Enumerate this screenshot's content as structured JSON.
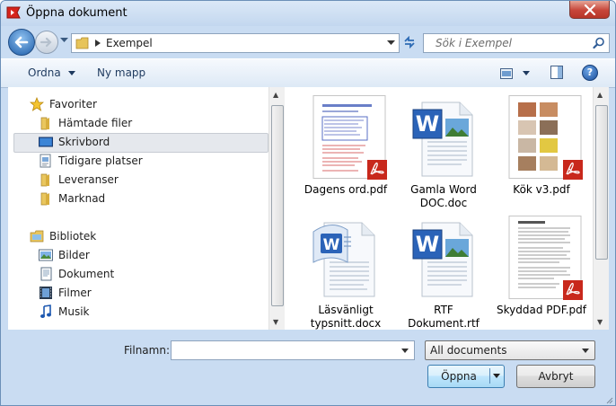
{
  "window": {
    "title": "Öppna dokument",
    "close_symbol": "✕"
  },
  "navigation": {
    "address_label": "Exempel",
    "search_placeholder": "Sök i Exempel"
  },
  "toolbar": {
    "organize_label": "Ordna",
    "new_folder_label": "Ny mapp",
    "help_symbol": "?"
  },
  "sidebar": {
    "favorites_label": "Favoriter",
    "favorites": [
      {
        "label": "Hämtade filer",
        "icon": "folder-icon"
      },
      {
        "label": "Skrivbord",
        "icon": "desktop-icon",
        "selected": true
      },
      {
        "label": "Tidigare platser",
        "icon": "recent-places-icon"
      },
      {
        "label": "Leveranser",
        "icon": "folder-icon"
      },
      {
        "label": "Marknad",
        "icon": "folder-icon"
      }
    ],
    "libraries_label": "Bibliotek",
    "libraries": [
      {
        "label": "Bilder",
        "icon": "pictures-icon"
      },
      {
        "label": "Dokument",
        "icon": "documents-icon"
      },
      {
        "label": "Filmer",
        "icon": "videos-icon"
      },
      {
        "label": "Musik",
        "icon": "music-icon"
      }
    ]
  },
  "files": [
    {
      "name": "Dagens ord.pdf",
      "type": "pdf-document"
    },
    {
      "name": "Gamla Word\nDOC.doc",
      "type": "word-document"
    },
    {
      "name": "Kök v3.pdf",
      "type": "pdf-photos"
    },
    {
      "name": "Läsvänligt\ntypsnitt.docx",
      "type": "word-docx"
    },
    {
      "name": "RTF\nDokument.rtf",
      "type": "word-document"
    },
    {
      "name": "Skyddad PDF.pdf",
      "type": "pdf-text"
    }
  ],
  "bottom": {
    "filename_label": "Filnamn:",
    "filename_value": "",
    "filter_value": "All documents",
    "open_label": "Öppna",
    "cancel_label": "Avbryt"
  },
  "colors": {
    "window_frame": "#c9dcf2",
    "selection": "#e5e8ed",
    "pdf_red": "#c8281c",
    "word_blue": "#2b63b8"
  }
}
